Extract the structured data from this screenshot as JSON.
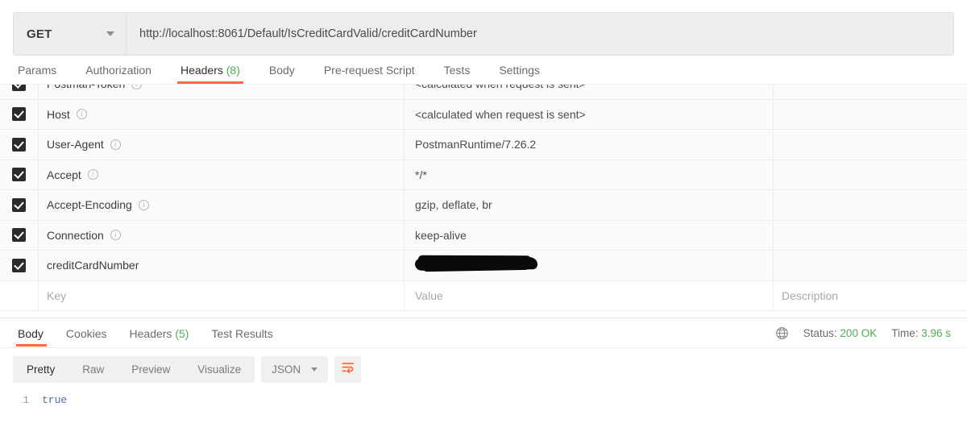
{
  "request": {
    "method": "GET",
    "url": "http://localhost:8061/Default/IsCreditCardValid/creditCardNumber",
    "tabs": [
      {
        "label": "Params",
        "count": "",
        "active": false
      },
      {
        "label": "Authorization",
        "count": "",
        "active": false
      },
      {
        "label": "Headers",
        "count": "(8)",
        "active": true
      },
      {
        "label": "Body",
        "count": "",
        "active": false
      },
      {
        "label": "Pre-request Script",
        "count": "",
        "active": false
      },
      {
        "label": "Tests",
        "count": "",
        "active": false
      },
      {
        "label": "Settings",
        "count": "",
        "active": false
      }
    ]
  },
  "headers_table": {
    "columns": {
      "key": "Key",
      "value": "Value",
      "description": "Description"
    },
    "rows": [
      {
        "checked": true,
        "key": "Postman-Token",
        "info": true,
        "value": "<calculated when request is sent>",
        "description": "",
        "redacted": false
      },
      {
        "checked": true,
        "key": "Host",
        "info": true,
        "value": "<calculated when request is sent>",
        "description": "",
        "redacted": false
      },
      {
        "checked": true,
        "key": "User-Agent",
        "info": true,
        "value": "PostmanRuntime/7.26.2",
        "description": "",
        "redacted": false
      },
      {
        "checked": true,
        "key": "Accept",
        "info": true,
        "value": "*/*",
        "description": "",
        "redacted": false
      },
      {
        "checked": true,
        "key": "Accept-Encoding",
        "info": true,
        "value": "gzip, deflate, br",
        "description": "",
        "redacted": false
      },
      {
        "checked": true,
        "key": "Connection",
        "info": true,
        "value": "keep-alive",
        "description": "",
        "redacted": false
      },
      {
        "checked": true,
        "key": "creditCardNumber",
        "info": false,
        "value": "",
        "description": "",
        "redacted": true
      }
    ]
  },
  "response": {
    "tabs": [
      {
        "label": "Body",
        "count": "",
        "active": true
      },
      {
        "label": "Cookies",
        "count": "",
        "active": false
      },
      {
        "label": "Headers",
        "count": "(5)",
        "active": false
      },
      {
        "label": "Test Results",
        "count": "",
        "active": false
      }
    ],
    "status_label": "Status:",
    "status_value": "200 OK",
    "time_label": "Time:",
    "time_value": "3.96 s",
    "toolbar": {
      "views": [
        {
          "label": "Pretty",
          "active": true
        },
        {
          "label": "Raw",
          "active": false
        },
        {
          "label": "Preview",
          "active": false
        },
        {
          "label": "Visualize",
          "active": false
        }
      ],
      "format": "JSON"
    },
    "body": {
      "line_number": "1",
      "content": "true"
    }
  },
  "colors": {
    "accent_orange": "#ff6c37",
    "status_green": "#4caf50",
    "boolean_blue": "#4a6fa5",
    "redaction_black": "#0a0a0a"
  }
}
